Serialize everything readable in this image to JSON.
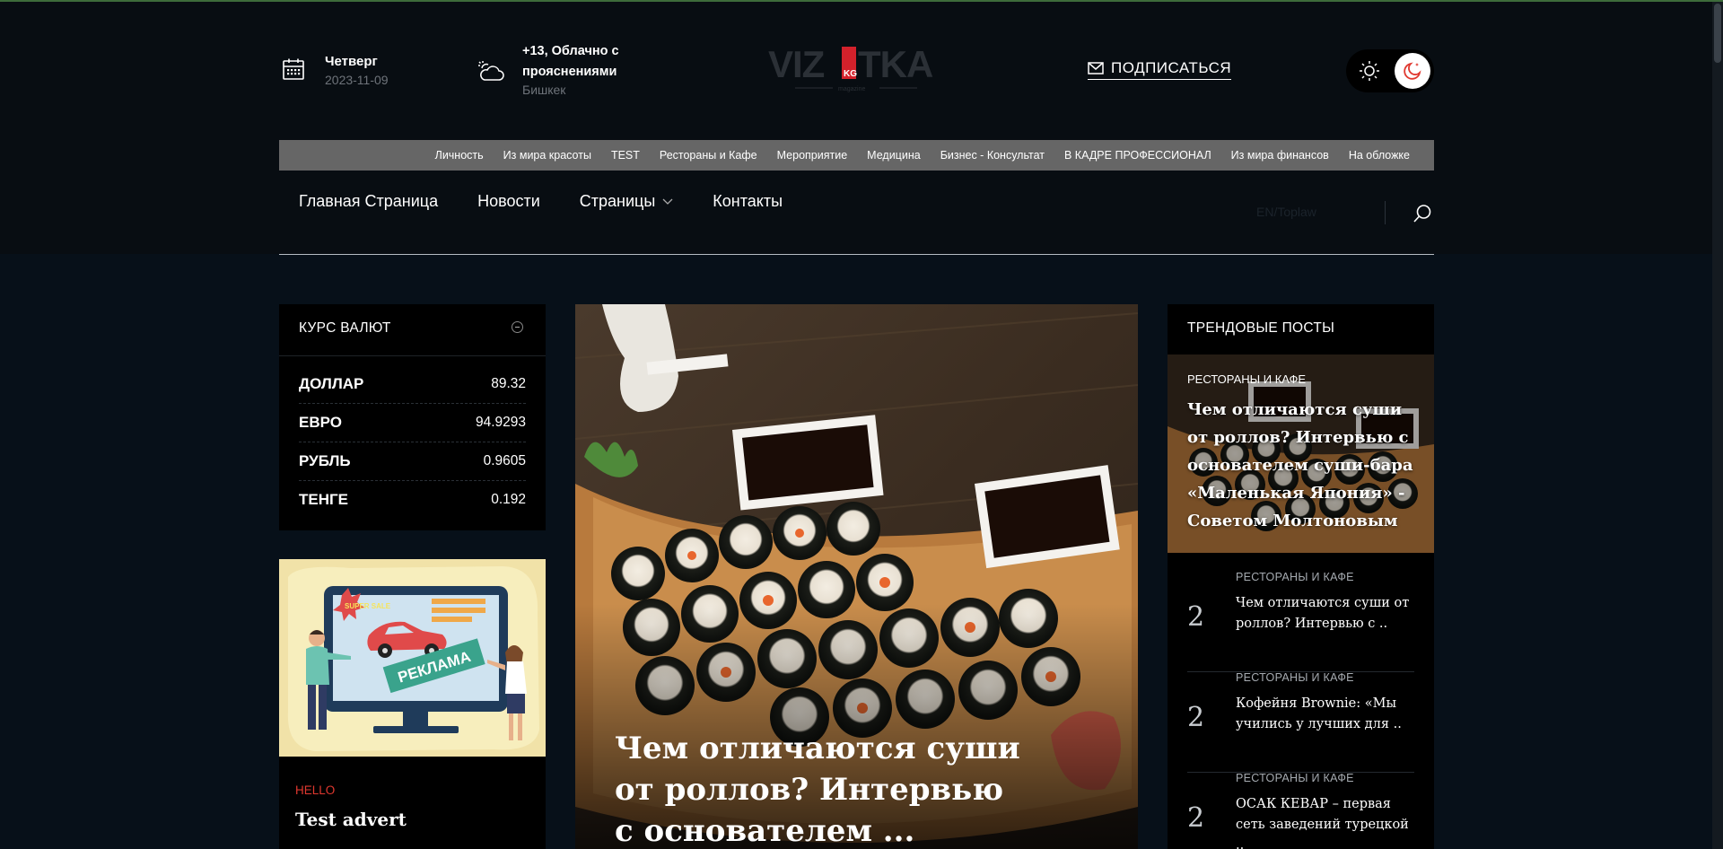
{
  "header": {
    "date_day": "Четверг",
    "date_value": "2023-11-09",
    "weather_text": "+13, Облачно с прояснениями",
    "weather_city": "Бишкек",
    "logo_text": "VIZITKA",
    "logo_badge": "KG",
    "logo_sub": "magazine",
    "subscribe_label": "ПОДПИСАТЬСЯ"
  },
  "categories": [
    "Личность",
    "Из мира красоты",
    "TEST",
    "Рестораны и Кафе",
    "Мероприятие",
    "Медицина",
    "Бизнес - Консультат",
    "В КАДРЕ ПРОФЕССИОНАЛ",
    "Из мира финансов",
    "На обложке"
  ],
  "nav": {
    "items": [
      "Главная Страница",
      "Новости",
      "Страницы",
      "Контакты"
    ],
    "lang": "EN/Toplaw"
  },
  "currency": {
    "title": "КУРС ВАЛЮТ",
    "rows": [
      {
        "name": "ДОЛЛАР",
        "value": "89.32"
      },
      {
        "name": "ЕВРО",
        "value": "94.9293"
      },
      {
        "name": "РУБЛЬ",
        "value": "0.9605"
      },
      {
        "name": "ТЕНГЕ",
        "value": "0.192"
      }
    ]
  },
  "ad": {
    "banner_text": "РЕКЛАМА",
    "sale_text": "SUPER SALE",
    "category": "HELLO",
    "title": "Test advert"
  },
  "hero": {
    "title": "Чем отличаются суши от роллов? Интервью с основателем ..."
  },
  "trending": {
    "title": "ТРЕНДОВЫЕ ПОСТЫ",
    "featured": {
      "category": "РЕСТОРАНЫ И КАФЕ",
      "title": "Чем отличаются суши от роллов? Интервью с основателем суши-бара «Маленькая Япония» - Советом Молтоновым"
    },
    "items": [
      {
        "num": "2",
        "category": "РЕСТОРАНЫ И КАФЕ",
        "title": "Чем отличаются суши от роллов? Интервью с .."
      },
      {
        "num": "2",
        "category": "РЕСТОРАНЫ И КАФЕ",
        "title": "Кофейня Brownie: «Мы учились у лучших для .."
      },
      {
        "num": "2",
        "category": "РЕСТОРАНЫ И КАФЕ",
        "title": "ОСАК КЕВАР – первая сеть заведений турецкой .."
      }
    ]
  }
}
